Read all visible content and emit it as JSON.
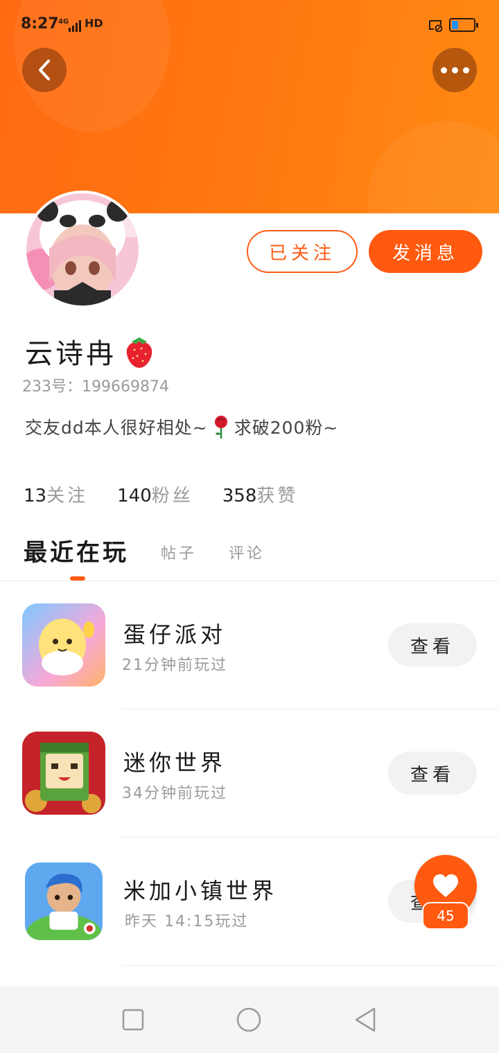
{
  "status_bar": {
    "time": "8:27",
    "network": "4G",
    "hd": "HD",
    "battery_level": 0.3
  },
  "header": {
    "back_icon": "chevron-left-icon",
    "more_icon": "more-dots-icon"
  },
  "profile": {
    "follow_label": "已关注",
    "message_label": "发消息",
    "username": "云诗冉",
    "username_emoji": "strawberry-icon",
    "uid": "233号：199669874",
    "bio_part1": "交友dd本人很好相处~",
    "bio_emoji": "rose-icon",
    "bio_part2": "求破200粉~"
  },
  "stats": [
    {
      "num": "13",
      "label": "关注"
    },
    {
      "num": "140",
      "label": "粉丝"
    },
    {
      "num": "358",
      "label": "获赞"
    }
  ],
  "tabs": {
    "active": "最近在玩",
    "items": [
      "帖子",
      "评论"
    ]
  },
  "games": [
    {
      "name": "蛋仔派对",
      "time": "21分钟前玩过",
      "button": "查看"
    },
    {
      "name": "迷你世界",
      "time": "34分钟前玩过",
      "button": "查看"
    },
    {
      "name": "米加小镇世界",
      "time": "昨天 14:15玩过",
      "button": "查看"
    }
  ],
  "like": {
    "icon": "heart-icon",
    "count": "45"
  },
  "nav": {
    "items": [
      "recent-apps-icon",
      "home-icon",
      "back-triangle-icon"
    ]
  },
  "colors": {
    "accent": "#ff5a0f",
    "banner": "#ff7a10"
  }
}
